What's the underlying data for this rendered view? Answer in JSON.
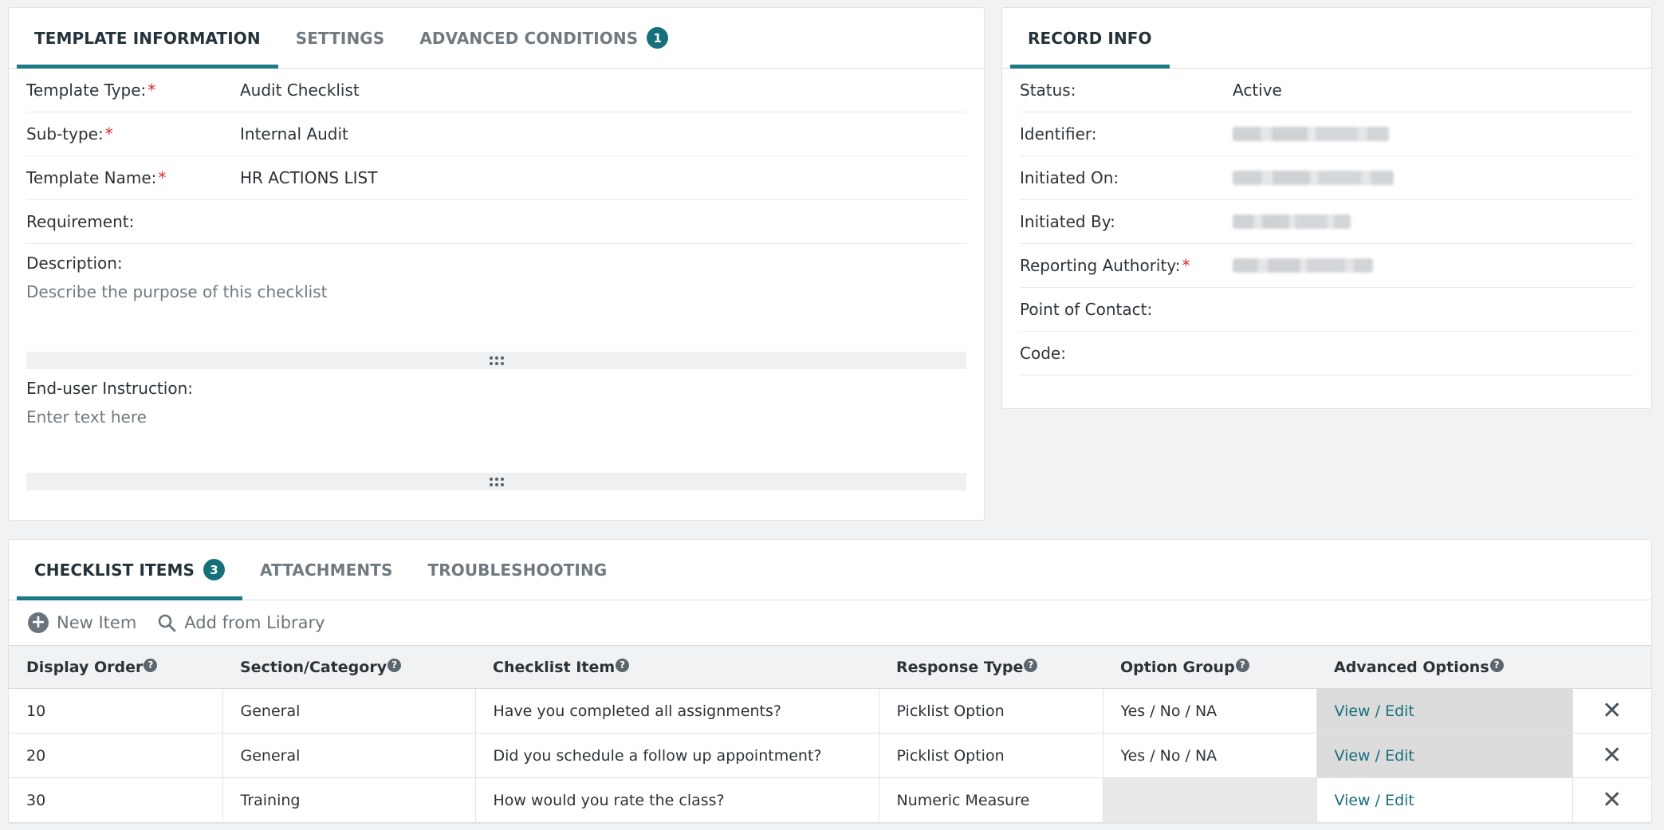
{
  "template_panel": {
    "tabs": [
      {
        "label": "TEMPLATE INFORMATION"
      },
      {
        "label": "SETTINGS"
      },
      {
        "label": "ADVANCED CONDITIONS",
        "badge": "1"
      }
    ],
    "fields": [
      {
        "label": "Template Type:",
        "required": "*",
        "value": "Audit Checklist"
      },
      {
        "label": "Sub-type:",
        "required": "*",
        "value": "Internal Audit"
      },
      {
        "label": "Template Name:",
        "required": "*",
        "value": "HR ACTIONS LIST"
      },
      {
        "label": "Requirement:",
        "value": ""
      }
    ],
    "description": {
      "label": "Description:",
      "placeholder": "Describe the purpose of this checklist"
    },
    "instruction": {
      "label": "End-user Instruction:",
      "placeholder": "Enter text here"
    }
  },
  "record_panel": {
    "tab": "RECORD INFO",
    "fields": [
      {
        "label": "Status:",
        "value": "Active"
      },
      {
        "label": "Identifier:",
        "value": ""
      },
      {
        "label": "Initiated On:",
        "value": ""
      },
      {
        "label": "Initiated By:",
        "value": ""
      },
      {
        "label": "Reporting Authority:",
        "required": "*",
        "value": ""
      },
      {
        "label": "Point of Contact:",
        "value": ""
      },
      {
        "label": "Code:",
        "value": ""
      }
    ]
  },
  "checklist_panel": {
    "tabs": [
      {
        "label": "CHECKLIST ITEMS",
        "badge": "3"
      },
      {
        "label": "ATTACHMENTS"
      },
      {
        "label": "TROUBLESHOOTING"
      }
    ],
    "toolbar": {
      "new_item": "New Item",
      "add_library": "Add from Library"
    },
    "columns": [
      "Display Order",
      "Section/Category",
      "Checklist Item",
      "Response Type",
      "Option Group",
      "Advanced Options"
    ],
    "help_glyph": "?",
    "link_label": "View / Edit",
    "remove_glyph": "✕",
    "rows": [
      {
        "order": "10",
        "section": "General",
        "item": "Have you completed all assignments?",
        "response": "Picklist Option",
        "option_group": "Yes / No / NA"
      },
      {
        "order": "20",
        "section": "General",
        "item": "Did you schedule a follow up appointment?",
        "response": "Picklist Option",
        "option_group": "Yes / No / NA"
      },
      {
        "order": "30",
        "section": "Training",
        "item": "How would you rate the class?",
        "response": "Numeric Measure",
        "option_group": ""
      }
    ]
  }
}
